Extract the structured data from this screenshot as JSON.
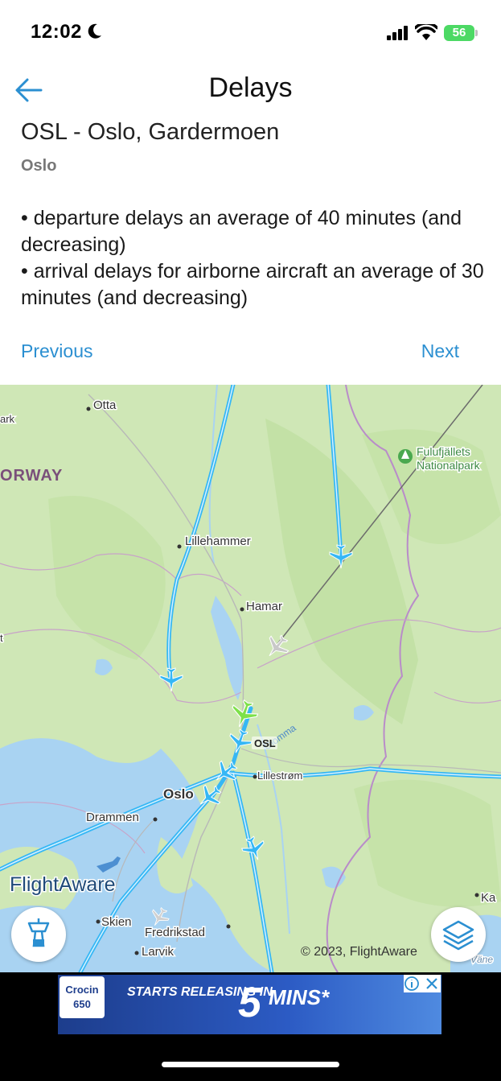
{
  "status_bar": {
    "time": "12:02",
    "battery": "56"
  },
  "header": {
    "title": "Delays"
  },
  "airport": {
    "name": "OSL - Oslo, Gardermoen",
    "city": "Oslo",
    "delays": [
      "• departure delays an average of 40 minutes (and decreasing)",
      "• arrival delays for airborne aircraft an average of 30 minutes (and decreasing)"
    ]
  },
  "nav": {
    "previous": "Previous",
    "next": "Next"
  },
  "map": {
    "labels": {
      "otta": "Otta",
      "ark": "ark",
      "norway": "ORWAY",
      "fulufjallets": "Fulufjällets",
      "nationalpark": "Nationalpark",
      "lillehammer": "Lillehammer",
      "hamar": "Hamar",
      "osl": "OSL",
      "lillestrom": "Lillestrøm",
      "oslo": "Oslo",
      "drammen": "Drammen",
      "skien": "Skien",
      "fredrikstad": "Fredrikstad",
      "larvik": "Larvik",
      "glomma": "Glomma",
      "ka": "Ka",
      "vane": "Väne",
      "t": "t"
    },
    "brand": "FlightAware",
    "copyright": "© 2023, FlightAware",
    "colors": {
      "water": "#a9d3f2",
      "land": "#cfe7b6",
      "track": "#35b7f5",
      "selected_plane": "#7ee14a"
    }
  },
  "ad": {
    "brand": "Crocin",
    "brand_sub": "650",
    "headline": "STARTS RELEASING IN",
    "number": "5",
    "unit": "MINS*"
  }
}
